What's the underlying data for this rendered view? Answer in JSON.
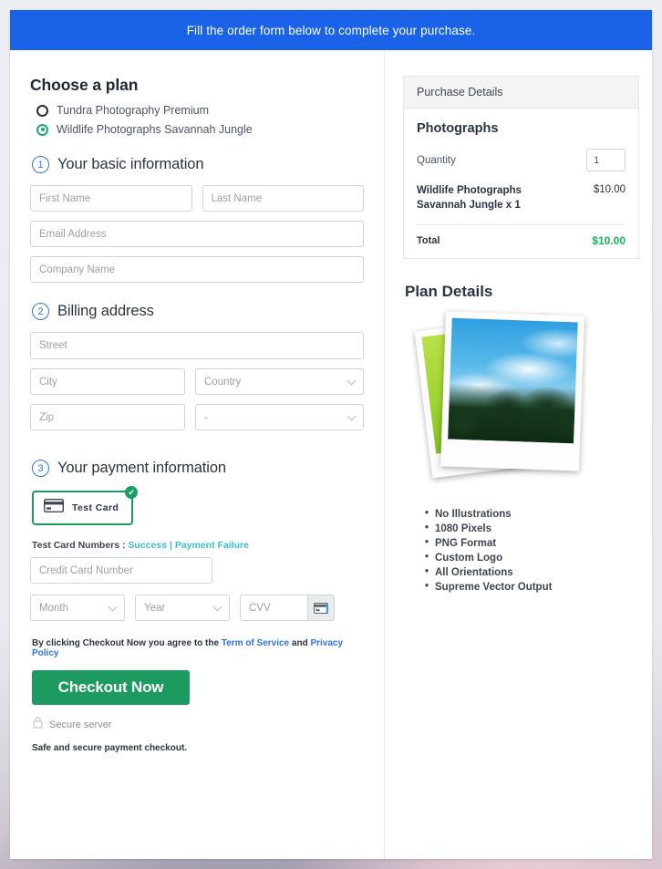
{
  "banner": {
    "text": "Fill the order form below to complete your purchase."
  },
  "plans": {
    "title": "Choose a plan",
    "options": [
      {
        "label": "Tundra Photography Premium",
        "selected": false
      },
      {
        "label": "Wildlife Photographs Savannah Jungle",
        "selected": true
      }
    ]
  },
  "step1": {
    "number": "1",
    "title": "Your basic information",
    "first_name_placeholder": "First Name",
    "last_name_placeholder": "Last Name",
    "email_placeholder": "Email Address",
    "company_placeholder": "Company Name"
  },
  "step2": {
    "number": "2",
    "title": "Billing address",
    "street_placeholder": "Street",
    "city_placeholder": "City",
    "country_placeholder": "Country",
    "zip_placeholder": "Zip",
    "state_placeholder": "-"
  },
  "step3": {
    "number": "3",
    "title": "Your payment information",
    "test_card_label": "Test  Card",
    "test_card_selected_badge": "✔",
    "test_numbers_prefix": "Test Card Numbers : ",
    "test_numbers_success": "Success",
    "test_numbers_separator": " | ",
    "test_numbers_failure": "Payment Failure",
    "card_number_placeholder": "Credit Card Number",
    "month_placeholder": "Month",
    "year_placeholder": "Year",
    "cvv_placeholder": "CVV"
  },
  "footer": {
    "terms_prefix": "By clicking Checkout Now you agree to the ",
    "terms_link": "Term of Service",
    "terms_middle": " and ",
    "privacy_link": "Privacy Policy",
    "checkout_label": "Checkout Now",
    "secure_server": "Secure server",
    "safe_note": "Safe and secure payment checkout."
  },
  "purchase": {
    "panel_title": "Purchase Details",
    "item_group": "Photographs",
    "quantity_label": "Quantity",
    "quantity_value": "1",
    "line_item_name": "Wildlife Photographs Savannah Jungle x 1",
    "line_item_price": "$10.00",
    "total_label": "Total",
    "total_value": "$10.00"
  },
  "plan_details": {
    "title": "Plan Details",
    "features": [
      "No Illustrations",
      "1080 Pixels",
      "PNG Format",
      "Custom Logo",
      "All Orientations",
      "Supreme Vector Output"
    ]
  },
  "colors": {
    "banner_blue": "#1a63e8",
    "accent_green": "#1d9a5f",
    "link_blue": "#2f74e0",
    "link_teal": "#3bbfd0",
    "step_blue": "#2f74e0",
    "total_green": "#19b35f"
  }
}
